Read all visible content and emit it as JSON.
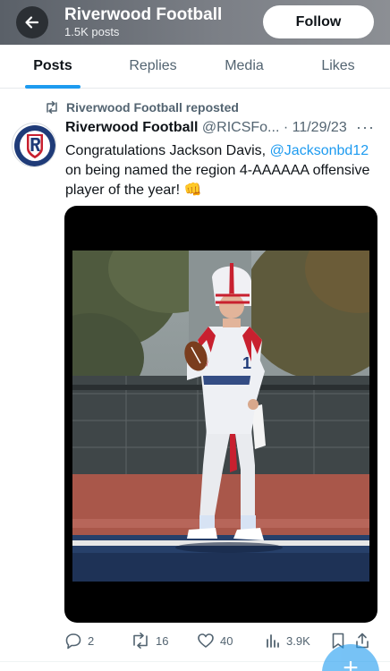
{
  "header": {
    "title": "Riverwood Football",
    "subtitle": "1.5K posts",
    "follow_label": "Follow"
  },
  "tabs": [
    {
      "label": "Posts",
      "active": true
    },
    {
      "label": "Replies",
      "active": false
    },
    {
      "label": "Media",
      "active": false
    },
    {
      "label": "Likes",
      "active": false
    }
  ],
  "repost": {
    "text": "Riverwood Football reposted"
  },
  "tweet": {
    "name": "Riverwood Football",
    "handle": "@RICSFo...",
    "date": "· 11/29/23",
    "more": "···",
    "text_before": "Congratulations Jackson Davis, ",
    "mention": "@Jacksonbd12",
    "text_after": " on being named the region 4-AAAAAA offensive player of the year! 👊",
    "image_jersey_number": "12"
  },
  "actions": {
    "replies": "2",
    "reposts": "16",
    "likes": "40",
    "views": "3.9K"
  },
  "colors": {
    "accent": "#1d9bf0",
    "text": "#0f1419",
    "muted": "#536471"
  },
  "icons": {
    "back": "arrow-left-icon",
    "repost": "repost-icon",
    "reply": "reply-icon",
    "like": "heart-icon",
    "views": "views-icon",
    "bookmark": "bookmark-icon",
    "compose": "plus-icon"
  }
}
